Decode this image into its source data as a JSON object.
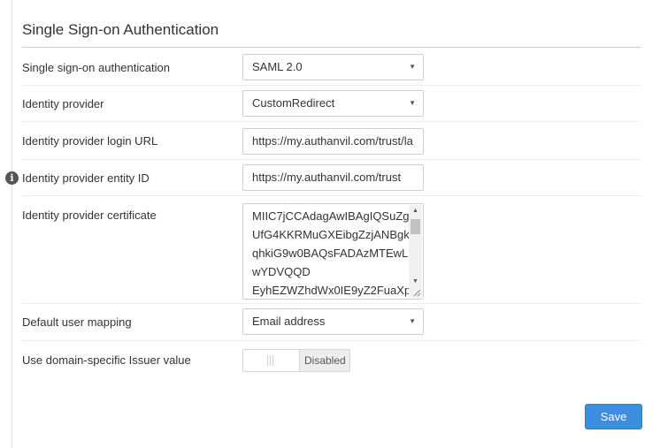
{
  "section": {
    "title": "Single Sign-on Authentication"
  },
  "fields": {
    "sso": {
      "label": "Single sign-on authentication",
      "value": "SAML 2.0"
    },
    "idp": {
      "label": "Identity provider",
      "value": "CustomRedirect"
    },
    "login_url": {
      "label": "Identity provider login URL",
      "value": "https://my.authanvil.com/trust/lа"
    },
    "entity_id": {
      "label": "Identity provider entity ID",
      "value": "https://my.authanvil.com/trust"
    },
    "certificate": {
      "label": "Identity provider certificate",
      "lines": [
        "MIIC7jCCAdagAwIBAgIQSuZg",
        "UfG4KKRMuGXEibgZzjANBgk",
        "qhkiG9w0BAQsFADAzMTEwL",
        "wYDVQQD",
        "EyhEZWZhdWx0IE9yZ2FuaXp"
      ]
    },
    "user_mapping": {
      "label": "Default user mapping",
      "value": "Email address"
    },
    "issuer": {
      "label": "Use domain-specific Issuer value",
      "state": "Disabled"
    }
  },
  "actions": {
    "save_label": "Save"
  },
  "icons": {
    "info": "info-icon",
    "dropdown": "chevron-down-icon"
  },
  "colors": {
    "primary": "#3d8ede",
    "border": "#cfcfcf"
  }
}
